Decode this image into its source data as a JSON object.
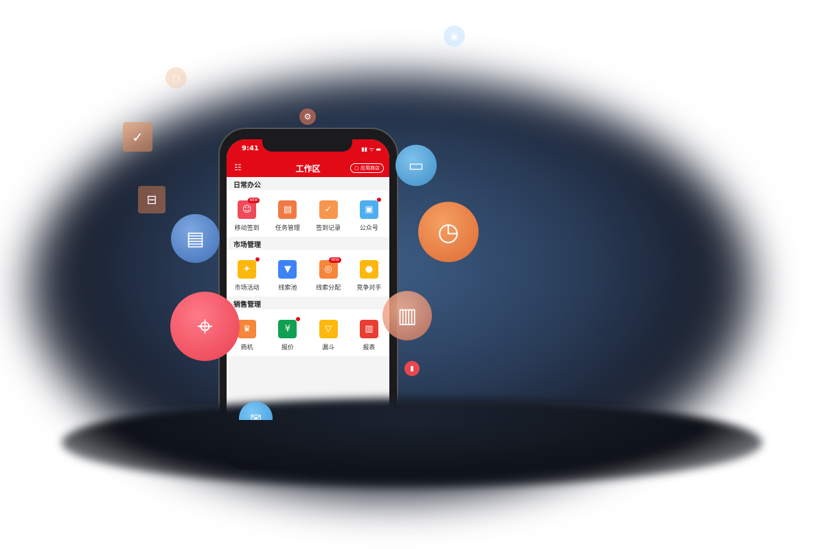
{
  "status": {
    "time": "9:41",
    "signal": "▮▮ ᯤ ▬"
  },
  "header": {
    "title": "工作区",
    "store_label": "▢ 应用商店",
    "menu_icon": "list-icon"
  },
  "sections": [
    {
      "title": "日常办公",
      "items": [
        {
          "label": "移动签到",
          "glyph": "☺",
          "color": "#f04a5a",
          "badge": "NEW"
        },
        {
          "label": "任务管理",
          "glyph": "▤",
          "color": "#f07a45",
          "badge": ""
        },
        {
          "label": "签到记录",
          "glyph": "✓",
          "color": "#f7974d",
          "badge": ""
        },
        {
          "label": "公众号",
          "glyph": "▣",
          "color": "#4faef0",
          "badge": "dot"
        }
      ]
    },
    {
      "title": "市场管理",
      "items": [
        {
          "label": "市场活动",
          "glyph": "✦",
          "color": "#fdb80e",
          "badge": "dot"
        },
        {
          "label": "线索池",
          "glyph": "▼",
          "color": "#3d82f7",
          "badge": ""
        },
        {
          "label": "线索分配",
          "glyph": "◎",
          "color": "#f5863a",
          "badge": "NEW"
        },
        {
          "label": "竞争对手",
          "glyph": "●",
          "color": "#fdb80e",
          "badge": ""
        }
      ]
    },
    {
      "title": "销售管理",
      "items": [
        {
          "label": "商机",
          "glyph": "♛",
          "color": "#f5863a",
          "badge": ""
        },
        {
          "label": "报价",
          "glyph": "¥",
          "color": "#11a052",
          "badge": "dot"
        },
        {
          "label": "漏斗",
          "glyph": "▽",
          "color": "#fdb80e",
          "badge": ""
        },
        {
          "label": "报表",
          "glyph": "▥",
          "color": "#ea3d33",
          "badge": ""
        }
      ]
    }
  ],
  "floating_icons": [
    "document-location-icon",
    "location-pin-icon",
    "presentation-board-icon",
    "document-clock-icon",
    "receipt-icon",
    "book-icon",
    "envelope-icon",
    "calendar-check-icon",
    "cabinet-icon",
    "gear-icon",
    "contact-icon",
    "card-icon"
  ]
}
